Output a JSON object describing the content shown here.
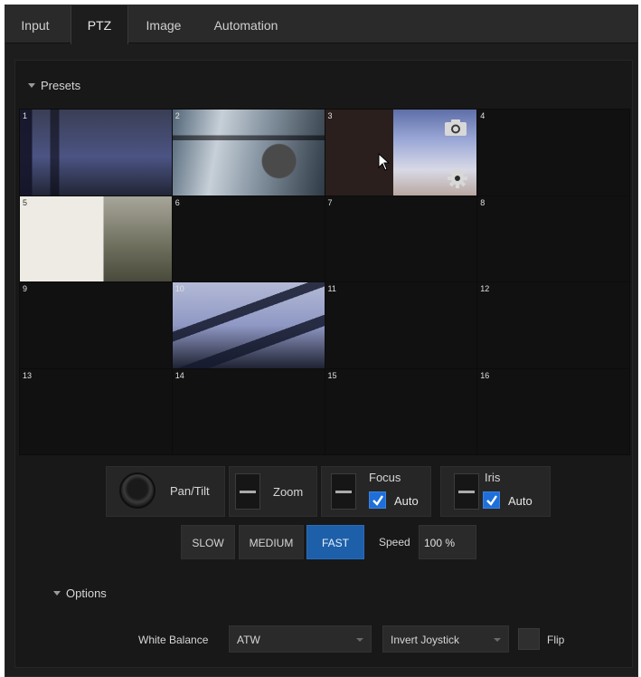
{
  "tabs": [
    {
      "label": "Input"
    },
    {
      "label": "PTZ"
    },
    {
      "label": "Image"
    },
    {
      "label": "Automation"
    }
  ],
  "active_tab": "PTZ",
  "presets": {
    "header": "Presets",
    "cells": [
      "1",
      "2",
      "3",
      "4",
      "5",
      "6",
      "7",
      "8",
      "9",
      "10",
      "11",
      "12",
      "13",
      "14",
      "15",
      "16"
    ],
    "hover_preset_icons": [
      "camera-icon",
      "gear-icon"
    ]
  },
  "controls": {
    "pan_tilt_label": "Pan/Tilt",
    "zoom_label": "Zoom",
    "focus_label": "Focus",
    "focus_auto_label": "Auto",
    "focus_auto_checked": true,
    "iris_label": "Iris",
    "iris_auto_label": "Auto",
    "iris_auto_checked": true
  },
  "speed": {
    "buttons": [
      "SLOW",
      "MEDIUM",
      "FAST"
    ],
    "selected": "FAST",
    "label": "Speed",
    "value": "100 %"
  },
  "options": {
    "header": "Options",
    "white_balance_label": "White Balance",
    "white_balance_value": "ATW",
    "invert_joystick_value": "Invert Joystick",
    "flip_label": "Flip",
    "flip_checked": false
  },
  "colors": {
    "accent": "#1e6fd9",
    "selected_button": "#1d5fa8",
    "panel_background": "#181818"
  }
}
